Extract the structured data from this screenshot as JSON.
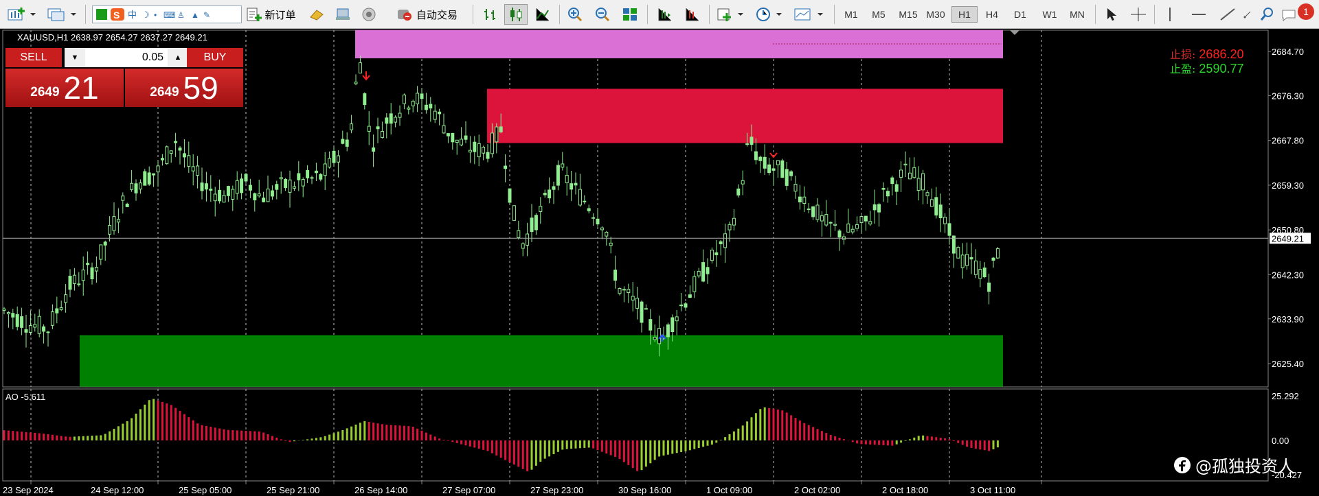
{
  "toolbar": {
    "new_order_label": "新订单",
    "auto_trading_label": "自动交易",
    "timeframes": [
      "M1",
      "M5",
      "M15",
      "M30",
      "H1",
      "H4",
      "D1",
      "W1",
      "MN"
    ],
    "active_timeframe": "H1",
    "notification_count": "1",
    "icons": [
      "new-chart-icon",
      "profiles-icon",
      "input-method-icon",
      "new-order-icon",
      "market-watch-icon",
      "navigator-icon",
      "signals-icon",
      "auto-trading-icon",
      "bar-chart-icon",
      "candlestick-icon",
      "line-chart-icon",
      "zoom-in-icon",
      "zoom-out-icon",
      "tile-windows-icon",
      "chart-shift-icon",
      "auto-scroll-icon",
      "indicators-icon",
      "periods-icon",
      "templates-icon",
      "cursor-icon",
      "crosshair-icon",
      "vertical-line-icon",
      "horizontal-line-icon",
      "trendline-icon",
      "fibonacci-icon",
      "search-icon",
      "chat-icon"
    ]
  },
  "chart": {
    "symbol_info": "XAUUSD,H1  2638.97 2654.27 2637.27 2649.21",
    "current_price": "2649.21",
    "price_levels": [
      "2684.70",
      "2676.30",
      "2667.80",
      "2659.30",
      "2650.80",
      "2642.30",
      "2633.90",
      "2625.40"
    ],
    "time_labels": [
      "23 Sep 2024",
      "24 Sep 12:00",
      "25 Sep 05:00",
      "25 Sep 21:00",
      "26 Sep 14:00",
      "27 Sep 07:00",
      "27 Sep 23:00",
      "30 Sep 16:00",
      "1 Oct 09:00",
      "2 Oct 02:00",
      "2 Oct 18:00",
      "3 Oct 11:00"
    ],
    "stop_loss_label": "止损:",
    "stop_loss_value": "2686.20",
    "take_profit_label": "止盈:",
    "take_profit_value": "2590.77",
    "zones": [
      {
        "name": "top-zone",
        "color": "#da70d6",
        "high": 2688.8,
        "low": 2683.4
      },
      {
        "name": "resistance-zone",
        "color": "#dc143c",
        "high": 2677.6,
        "low": 2667.3
      },
      {
        "name": "support-zone",
        "color": "#008000",
        "high": 2630.8,
        "low": 2621.0
      }
    ],
    "candle_color": "#90ee90",
    "bg_color": "#000000"
  },
  "trade_panel": {
    "sell_label": "SELL",
    "buy_label": "BUY",
    "lot_value": "0.05",
    "sell_price_small": "2649",
    "sell_price_big": "21",
    "buy_price_small": "2649",
    "buy_price_big": "59"
  },
  "indicator": {
    "label": "AO -5.611",
    "levels": [
      "25.292",
      "0.00",
      "-20.427"
    ],
    "up_color": "#9acd32",
    "down_color": "#dc143c"
  },
  "watermark": "@孤独投资人"
}
